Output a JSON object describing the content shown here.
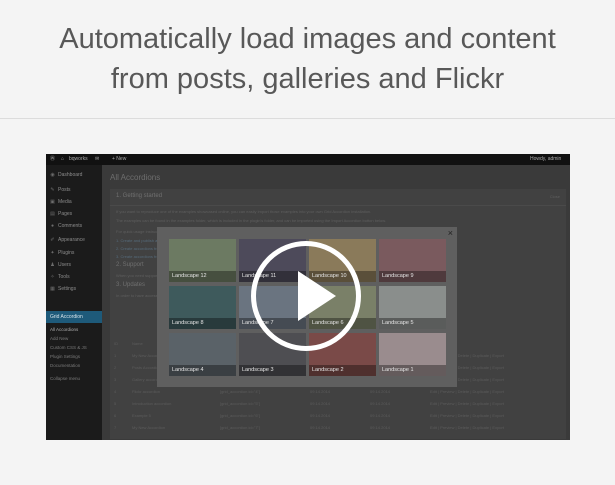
{
  "headline": {
    "line1": "Automatically load images and content",
    "line2": "from posts, galleries and Flickr"
  },
  "adminbar": {
    "site": "bqworks",
    "new": "+ New",
    "user": "Howdy, admin"
  },
  "sidebar": {
    "items": [
      {
        "icon": "◉",
        "label": "Dashboard"
      },
      {
        "icon": "✎",
        "label": "Posts"
      },
      {
        "icon": "▣",
        "label": "Media"
      },
      {
        "icon": "▤",
        "label": "Pages"
      },
      {
        "icon": "●",
        "label": "Comments"
      },
      {
        "icon": "✐",
        "label": "Appearance"
      },
      {
        "icon": "✦",
        "label": "Plugins"
      },
      {
        "icon": "♟",
        "label": "Users"
      },
      {
        "icon": "✧",
        "label": "Tools"
      },
      {
        "icon": "▦",
        "label": "Settings"
      }
    ],
    "active": "Grid Accordion",
    "sub": [
      "All Accordions",
      "Add New",
      "Custom CSS & JS",
      "Plugin Settings",
      "Documentation"
    ],
    "collapse": "Collapse menu"
  },
  "page": {
    "title": "All Accordions",
    "section1": "1. Getting started",
    "close_link": "Close",
    "intro1": "If you want to reproduce one of the examples showcased online, you can easily import those examples into your own Grid Accordion installation.",
    "intro2": "The examples can be found in the examples folder, which is included in the plugin's folder, and can be imported using the Import Accordion button below.",
    "intro3": "For quick usage instructions, please see the video tutorials below. For more detailed instructions, please see the documentation.",
    "link1": "1. Create and publish accordions",
    "link2": "2. Create accordions from posts",
    "link3": "3. Create accordions from galleries",
    "section2": "2. Support",
    "support_text": "When you need support, please contact us at our support center: support.bqworks.com",
    "section3": "3. Updates",
    "updates_text": "In order to have access to automatic updates, please enter your purchase code.",
    "columns": [
      "ID",
      "Name",
      "Shortcode",
      "Created",
      "Modified",
      "Actions"
    ],
    "rows": [
      {
        "id": "1",
        "name": "My New Accordion",
        "code": "[grid_accordion id=\"1\"]",
        "created": "09.14.2014",
        "modified": "09.14.2014",
        "actions": "Edit | Preview | Delete | Duplicate | Export"
      },
      {
        "id": "2",
        "name": "Posts Accordion",
        "code": "[grid_accordion id=\"2\"]",
        "created": "09.14.2014",
        "modified": "09.14.2014",
        "actions": "Edit | Preview | Delete | Duplicate | Export"
      },
      {
        "id": "3",
        "name": "Gallery accordion",
        "code": "[grid_accordion id=\"3\"]",
        "created": "09.14.2014",
        "modified": "09.14.2014",
        "actions": "Edit | Preview | Delete | Duplicate | Export"
      },
      {
        "id": "4",
        "name": "Flickr accordion",
        "code": "[grid_accordion id=\"4\"]",
        "created": "09.14.2014",
        "modified": "09.14.2014",
        "actions": "Edit | Preview | Delete | Duplicate | Export"
      },
      {
        "id": "5",
        "name": "Introduction accordion",
        "code": "[grid_accordion id=\"5\"]",
        "created": "09.14.2014",
        "modified": "09.14.2014",
        "actions": "Edit | Preview | Delete | Duplicate | Export"
      },
      {
        "id": "6",
        "name": "Example 5",
        "code": "[grid_accordion id=\"6\"]",
        "created": "09.14.2014",
        "modified": "09.14.2014",
        "actions": "Edit | Preview | Delete | Duplicate | Export"
      },
      {
        "id": "7",
        "name": "My New Accordion",
        "code": "[grid_accordion id=\"7\"]",
        "created": "09.14.2014",
        "modified": "09.14.2014",
        "actions": "Edit | Preview | Delete | Duplicate | Export"
      }
    ]
  },
  "lightbox": {
    "close": "×",
    "thumbs": [
      {
        "label": "Landscape 12",
        "color": "#6c7a62"
      },
      {
        "label": "Landscape 11",
        "color": "#4d4a5a"
      },
      {
        "label": "Landscape 10",
        "color": "#8a7a5a"
      },
      {
        "label": "Landscape 9",
        "color": "#7a5a5e"
      },
      {
        "label": "Landscape 8",
        "color": "#3e5a5c"
      },
      {
        "label": "Landscape 7",
        "color": "#6a7480"
      },
      {
        "label": "Landscape 6",
        "color": "#7a8068"
      },
      {
        "label": "Landscape 5",
        "color": "#8a8e8c"
      },
      {
        "label": "Landscape 4",
        "color": "#5a6268"
      },
      {
        "label": "Landscape 3",
        "color": "#4e4e52"
      },
      {
        "label": "Landscape 2",
        "color": "#7a4a48"
      },
      {
        "label": "Landscape 1",
        "color": "#9a8c8e"
      }
    ]
  }
}
